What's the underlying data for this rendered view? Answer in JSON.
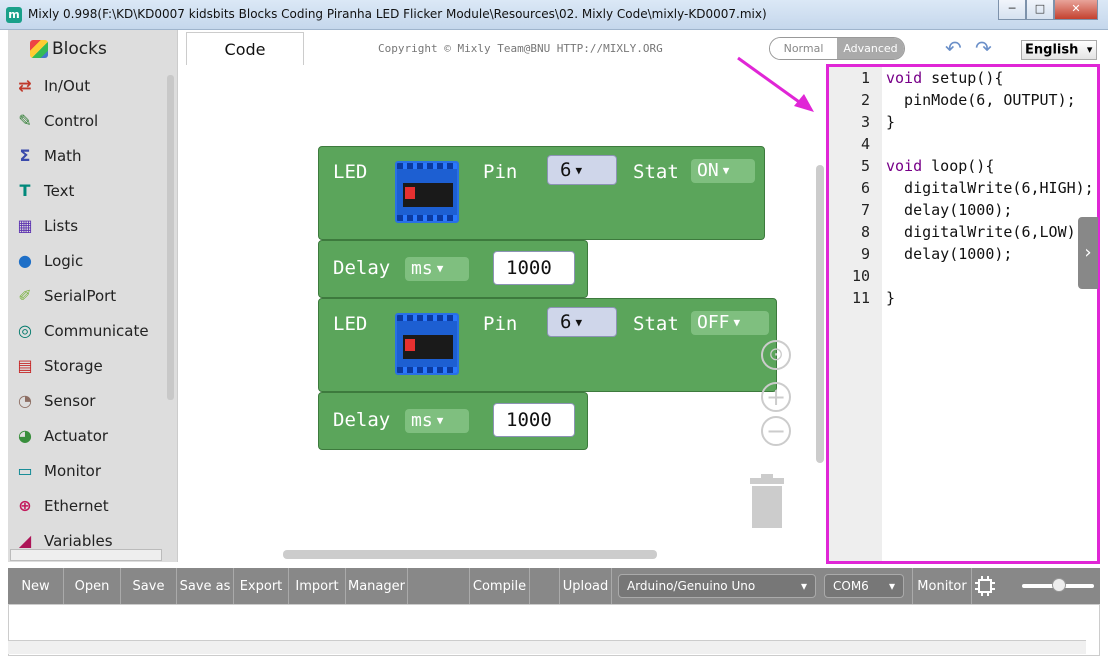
{
  "window": {
    "title": "Mixly 0.998(F:\\KD\\KD0007 kidsbits Blocks Coding Piranha LED Flicker  Module\\Resources\\02. Mixly Code\\mixly-KD0007.mix)",
    "app_icon": "m",
    "min": "─",
    "max": "□",
    "close": "✕"
  },
  "sidebar": {
    "header": "Blocks",
    "items": [
      {
        "label": "In/Out",
        "icon": "⇄",
        "color": "#c0392b"
      },
      {
        "label": "Control",
        "icon": "✎",
        "color": "#2e7d32"
      },
      {
        "label": "Math",
        "icon": "Σ",
        "color": "#3949ab"
      },
      {
        "label": "Text",
        "icon": "T",
        "color": "#00897b"
      },
      {
        "label": "Lists",
        "icon": "▦",
        "color": "#5e35b1"
      },
      {
        "label": "Logic",
        "icon": "●",
        "color": "#1e6fc7"
      },
      {
        "label": "SerialPort",
        "icon": "✐",
        "color": "#7cb342"
      },
      {
        "label": "Communicate",
        "icon": "◎",
        "color": "#00796b"
      },
      {
        "label": "Storage",
        "icon": "▤",
        "color": "#c62828"
      },
      {
        "label": "Sensor",
        "icon": "◔",
        "color": "#8d6e63"
      },
      {
        "label": "Actuator",
        "icon": "◕",
        "color": "#388e3c"
      },
      {
        "label": "Monitor",
        "icon": "▭",
        "color": "#00838f"
      },
      {
        "label": "Ethernet",
        "icon": "⊕",
        "color": "#c2185b"
      },
      {
        "label": "Variables",
        "icon": "◢",
        "color": "#ad1457"
      }
    ]
  },
  "header": {
    "tab": "Code",
    "copyright": "Copyright © Mixly Team@BNU HTTP://MIXLY.ORG",
    "mode_normal": "Normal",
    "mode_advanced": "Advanced",
    "undo": "↶",
    "redo": "↷",
    "language": "English"
  },
  "blocks": {
    "led1": {
      "label": "LED",
      "pin_label": "Pin",
      "pin": "6",
      "stat_label": "Stat",
      "stat": "ON"
    },
    "delay1": {
      "label": "Delay",
      "unit": "ms",
      "value": "1000"
    },
    "led2": {
      "label": "LED",
      "pin_label": "Pin",
      "pin": "6",
      "stat_label": "Stat",
      "stat": "OFF"
    },
    "delay2": {
      "label": "Delay",
      "unit": "ms",
      "value": "1000"
    },
    "dropdown_arrow": "▼"
  },
  "workspace_controls": {
    "zoom_in": "+",
    "zoom_out": "−",
    "center": "⊙"
  },
  "code": {
    "line_numbers": [
      "1",
      "2",
      "3",
      "4",
      "5",
      "6",
      "7",
      "8",
      "9",
      "10",
      "11"
    ],
    "lines": [
      {
        "kw": "void",
        "rest": " setup(){"
      },
      {
        "text": "  pinMode(6, OUTPUT);"
      },
      {
        "text": "}"
      },
      {
        "text": ""
      },
      {
        "kw": "void",
        "rest": " loop(){"
      },
      {
        "text": "  digitalWrite(6,HIGH);"
      },
      {
        "text": "  delay(1000);"
      },
      {
        "text": "  digitalWrite(6,LOW);"
      },
      {
        "text": "  delay(1000);"
      },
      {
        "text": ""
      },
      {
        "text": "}"
      }
    ],
    "expander": "›"
  },
  "toolbar": {
    "new": "New",
    "open": "Open",
    "save": "Save",
    "save_as": "Save as",
    "export": "Export",
    "import": "Import",
    "manager": "Manager",
    "compile": "Compile",
    "upload": "Upload",
    "board": "Arduino/Genuino Uno",
    "port": "COM6",
    "monitor": "Monitor",
    "select_arrow": "▾"
  },
  "colors": {
    "block_green": "#5ba55b",
    "highlight_border": "#e026d6",
    "toolbar_bg": "#888888"
  }
}
